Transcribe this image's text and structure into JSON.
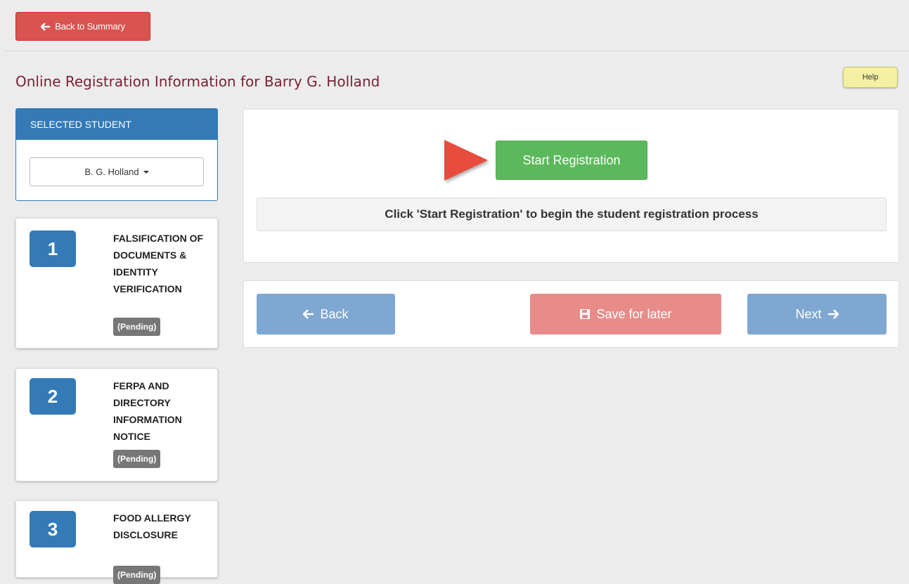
{
  "top": {
    "back_label": "Back to Summary"
  },
  "header": {
    "title": "Online Registration Information for Barry G. Holland",
    "help_label": "Help"
  },
  "sidebar": {
    "selected_heading": "SELECTED STUDENT",
    "student": "B. G. Holland",
    "steps": [
      {
        "number": "1",
        "title": "FALSIFICATION OF DOCUMENTS & IDENTITY VERIFICATION",
        "status": "(Pending)"
      },
      {
        "number": "2",
        "title": "FERPA AND DIRECTORY INFORMATION NOTICE",
        "status": "(Pending)"
      },
      {
        "number": "3",
        "title": "FOOD ALLERGY DISCLOSURE",
        "status": "(Pending)"
      }
    ]
  },
  "main": {
    "start_label": "Start Registration",
    "instruction": "Click 'Start Registration' to begin the student registration process",
    "nav": {
      "back_label": "Back",
      "save_label": "Save for later",
      "next_label": "Next"
    }
  },
  "colors": {
    "danger": "#d9534f",
    "primary": "#337ab7",
    "success": "#5cb85c",
    "title": "#7a1f35",
    "help": "#f3f0a3"
  },
  "icons": [
    "arrow-left-icon",
    "arrow-right-icon",
    "save-icon",
    "caret-down-icon",
    "pointer-arrow-icon"
  ]
}
